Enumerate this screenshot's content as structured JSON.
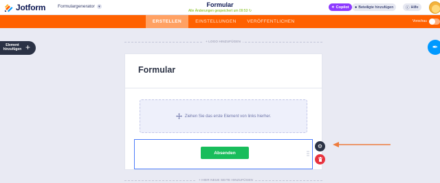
{
  "header": {
    "logo_text": "Jotform",
    "form_generator": "Formulargenerator",
    "title": "Formular",
    "saved_status": "Alle Änderungen gespeichert um 09:53",
    "copilot": "Copilot",
    "share": "Beteiligte hinzufügen",
    "help": "Hilfe"
  },
  "nav": {
    "tabs": [
      {
        "label": "ERSTELLEN",
        "active": true
      },
      {
        "label": "EINSTELLUNGEN",
        "active": false
      },
      {
        "label": "VERÖFFENTLICHEN",
        "active": false
      }
    ],
    "preview_label": "Vorschau",
    "preview_on": false
  },
  "sidebar": {
    "add_element": "Element hinzufügen"
  },
  "canvas": {
    "logo_add": "+ LOGO HINZUFÜGEN",
    "form_heading": "Formular",
    "dropzone_text": "Ziehen Sie das erste Element von links hierher.",
    "submit_label": "Absenden",
    "new_page": "+ HIER NEUE SEITE HINZUFÜGEN"
  },
  "colors": {
    "brand_orange": "#ff6100",
    "submit_green": "#18bd5b",
    "copilot_purple": "#8e3bff",
    "annotation_arrow": "#ee7b3b"
  },
  "icons": [
    "jotform-logo-icon",
    "chevron-down-icon",
    "copilot-icon",
    "user-icon",
    "help-icon",
    "plus-icon",
    "paint-roller-icon",
    "move-icon",
    "drag-handle-icon",
    "gear-icon",
    "trash-icon",
    "arrow-left-icon"
  ]
}
